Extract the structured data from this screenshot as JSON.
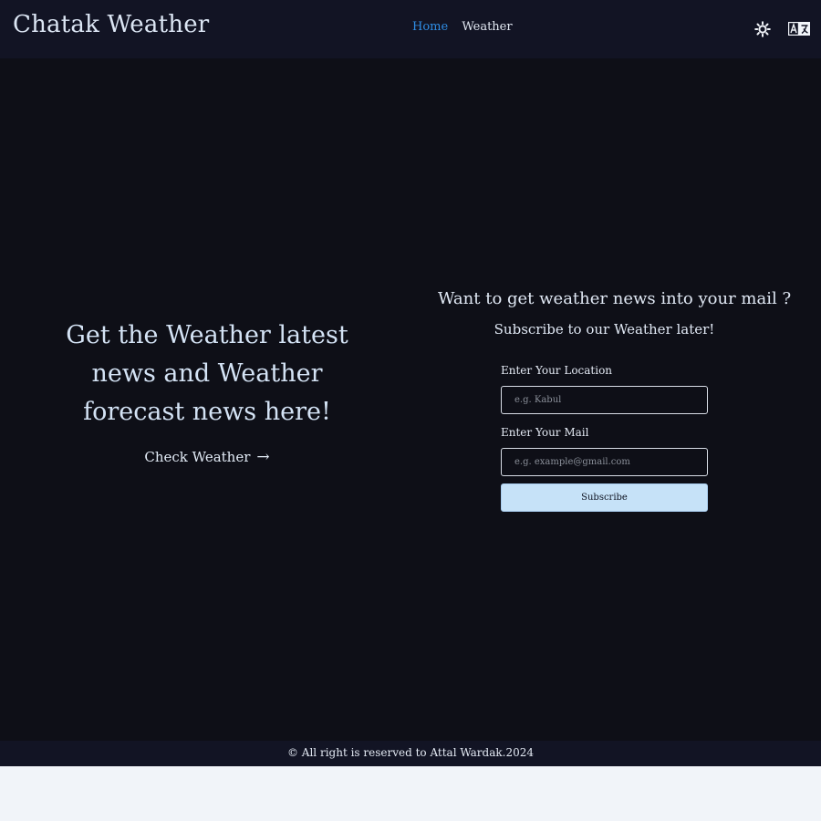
{
  "header": {
    "brand": "Chatak Weather",
    "nav": [
      {
        "label": "Home",
        "active": true
      },
      {
        "label": "Weather",
        "active": false
      }
    ],
    "theme_icon": "sun-icon",
    "language_icon": "translate-icon"
  },
  "hero": {
    "title": "Get the Weather latest news and Weather forecast news here!",
    "cta_label": "Check Weather",
    "cta_arrow": "→"
  },
  "subscribe": {
    "heading": "Want to get weather news into your mail ?",
    "subheading": "Subscribe to our Weather later!",
    "location_label": "Enter Your Location",
    "location_placeholder": "e.g. Kabul",
    "mail_label": "Enter Your Mail",
    "mail_placeholder": "e.g. example@gmail.com",
    "button_label": "Subscribe"
  },
  "footer": {
    "text": "© All right is reserved to Attal Wardak.2024"
  },
  "colors": {
    "header_bg": "#121424",
    "main_bg": "#0e0f17",
    "accent": "#2f8de4",
    "button_bg": "#c6e2f8",
    "page_bg": "#f1f4f9"
  }
}
